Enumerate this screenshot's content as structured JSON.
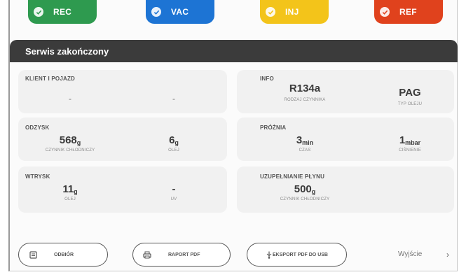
{
  "tabs": [
    {
      "label": "REC",
      "color": "#2e9a4f"
    },
    {
      "label": "VAC",
      "color": "#1d74d4"
    },
    {
      "label": "INJ",
      "color": "#f3c41a"
    },
    {
      "label": "REF",
      "color": "#e0421d"
    }
  ],
  "header": {
    "title": "Serwis zakończony"
  },
  "client": {
    "title": "KLIENT I POJAZD",
    "value1": "-",
    "value2": "-"
  },
  "info": {
    "title": "INFO",
    "refrigerant": "R134a",
    "refrigerant_label": "RODZAJ CZYNNIKA",
    "oil": "PAG",
    "oil_label": "TYP OLEJU"
  },
  "recovery": {
    "title": "ODZYSK",
    "refrigerant_value": "568",
    "refrigerant_unit": "g",
    "refrigerant_label": "CZYNNIK CHŁODNICZY",
    "oil_value": "6",
    "oil_unit": "g",
    "oil_label": "OLEJ"
  },
  "vacuum": {
    "title": "PRÓŻNIA",
    "time_value": "3",
    "time_unit": "min",
    "time_label": "CZAS",
    "pressure_value": "1",
    "pressure_unit": "mbar",
    "pressure_label": "CIŚNIENIE"
  },
  "injection": {
    "title": "WTRYSK",
    "oil_value": "11",
    "oil_unit": "g",
    "oil_label": "OLEJ",
    "uv_value": "-",
    "uv_label": "UV"
  },
  "fill": {
    "title": "UZUPEŁNIANIE PŁYNU",
    "value": "500",
    "unit": "g",
    "label": "CZYNNIK CHŁODNICZY"
  },
  "buttons": {
    "receipt": "ODBIÓR",
    "report": "RAPORT PDF",
    "export": "EKSPORT PDF DO USB",
    "exit": "Wyjście"
  }
}
